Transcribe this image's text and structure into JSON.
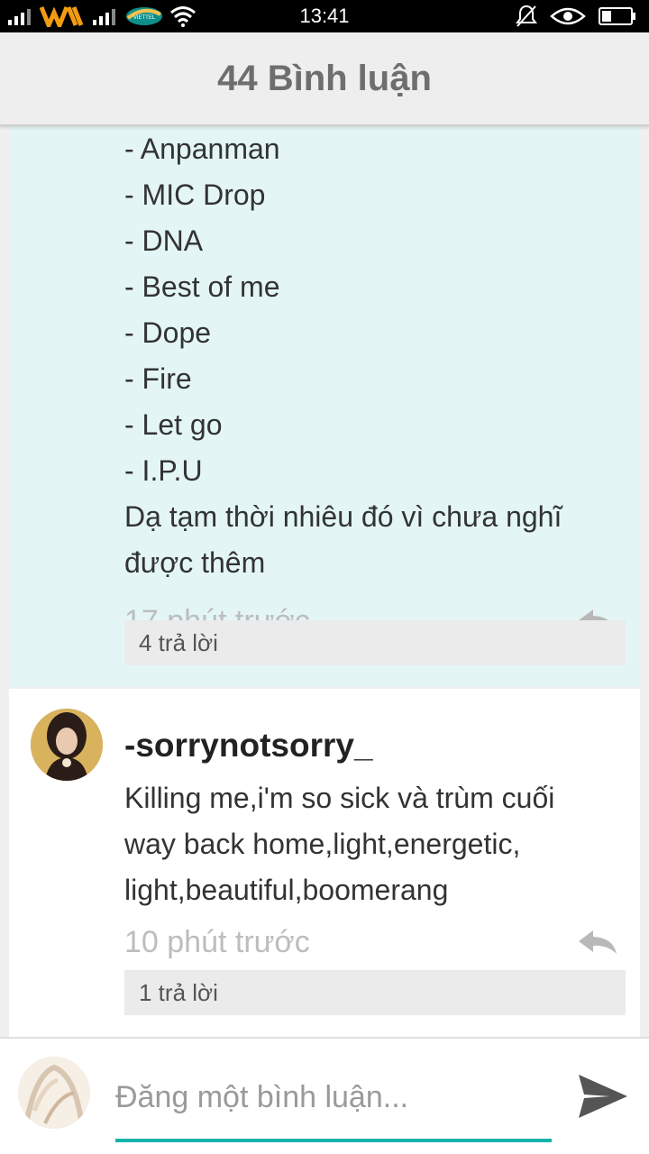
{
  "status_bar": {
    "time": "13:41",
    "carrier_logo_text": "VIETTEL"
  },
  "header": {
    "title": "44 Bình luận"
  },
  "comment_1": {
    "lines": [
      "- Anpanman",
      "- MIC Drop",
      "- DNA",
      "- Best of me",
      "- Dope",
      "- Fire",
      "- Let go",
      "- I.P.U",
      "Dạ tạm thời nhiêu đó vì chưa nghĩ",
      "được thêm"
    ],
    "time": "17 phút trước",
    "replies_label": "4 trả lời"
  },
  "comment_2": {
    "username": "-sorrynotsorry_",
    "lines": [
      "Killing me,i'm so sick và trùm cuối",
      "way back home,light,energetic,",
      "light,beautiful,boomerang"
    ],
    "time": "10 phút trước",
    "replies_label": "1 trả lời"
  },
  "composer": {
    "placeholder": "Đăng một bình luận..."
  },
  "colors": {
    "highlight_bg": "#e3f6f5",
    "accent": "#17b3ac",
    "muted_text": "#bdbdbd",
    "header_text": "#6e6e6e"
  },
  "icons": [
    "signal-icon",
    "wifi-icon",
    "mute-icon",
    "eye-icon",
    "battery-icon",
    "reply-icon",
    "send-icon"
  ]
}
